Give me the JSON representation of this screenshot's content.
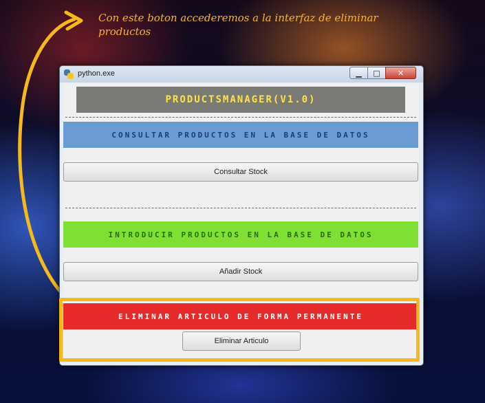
{
  "annotation": {
    "text": "Con este boton accederemos a la interfaz de eliminar productos",
    "color": "#f7b52a"
  },
  "window": {
    "title": "python.exe",
    "icon": "python-icon",
    "controls": [
      "minimize-icon",
      "maximize-icon",
      "close-icon"
    ]
  },
  "app": {
    "header": "PRODUCTSMANAGER(V1.0)",
    "sections": [
      {
        "banner": "Consultar productos en la base de datos",
        "button": "Consultar Stock",
        "color": "#6b9bd2"
      },
      {
        "banner": "Introducir productos en la base de datos",
        "button": "Añadir Stock",
        "color": "#7fe033"
      },
      {
        "banner": "Eliminar articulo de forma permanente",
        "button": "Eliminar Articulo",
        "color": "#e72a2a"
      }
    ]
  },
  "highlight_color": "#f6b81a"
}
